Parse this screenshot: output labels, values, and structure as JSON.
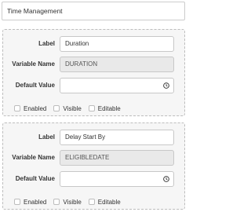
{
  "header": {
    "title": "Time Management"
  },
  "panels": [
    {
      "fields": {
        "label_label": "Label",
        "label_value": "Duration",
        "variable_label": "Variable Name",
        "variable_value": "DURATION",
        "default_label": "Default Value",
        "default_value": ""
      },
      "checks": {
        "enabled": "Enabled",
        "visible": "Visible",
        "editable": "Editable"
      }
    },
    {
      "fields": {
        "label_label": "Label",
        "label_value": "Delay Start By",
        "variable_label": "Variable Name",
        "variable_value": "ELIGIBLEDATE",
        "default_label": "Default Value",
        "default_value": ""
      },
      "checks": {
        "enabled": "Enabled",
        "visible": "Visible",
        "editable": "Editable"
      }
    }
  ],
  "icons": {
    "clock": "clock-icon"
  },
  "colors": {
    "panel_bg": "#f6f6f6",
    "readonly_bg": "#e9e9e9",
    "border": "#c8c8c8"
  }
}
